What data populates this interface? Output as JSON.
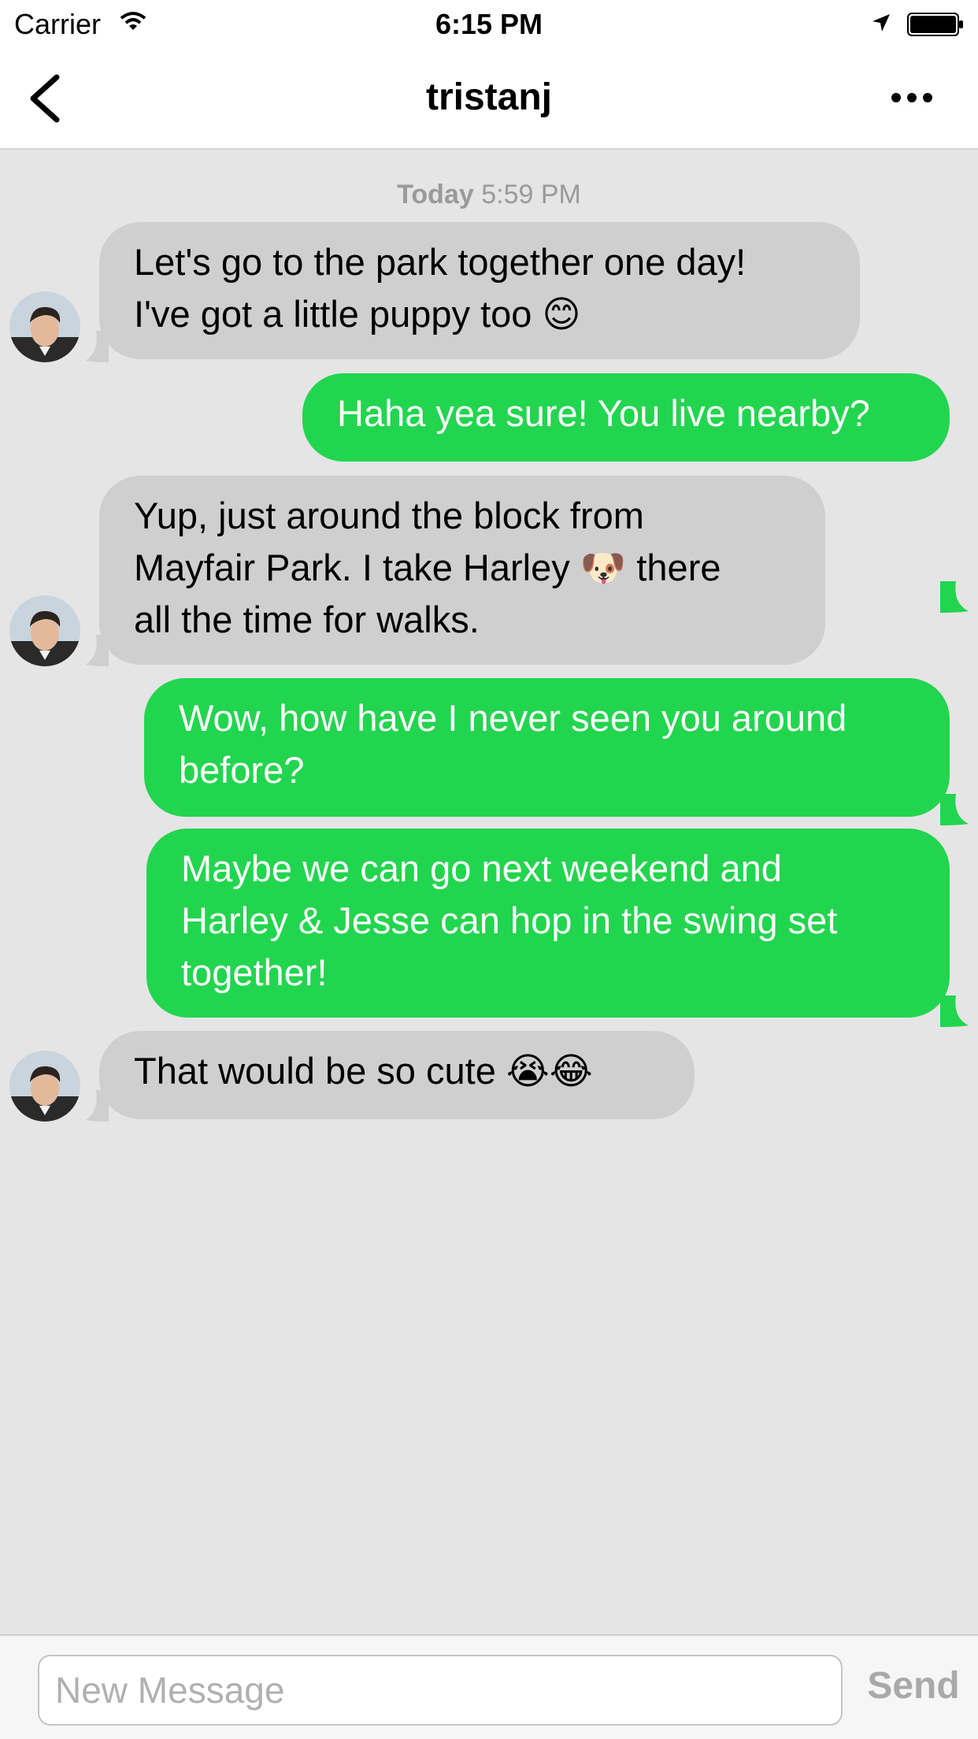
{
  "status_bar": {
    "carrier": "Carrier",
    "time": "6:15 PM"
  },
  "nav": {
    "title": "tristanj",
    "back_icon": "chevron-left-icon",
    "more_icon": "ellipsis-icon"
  },
  "thread": {
    "timestamp_day": "Today",
    "timestamp_time": "5:59 PM",
    "messages": [
      {
        "direction": "incoming",
        "lines": [
          "Let's go to the park together one day!",
          "I've got a little puppy too 😊"
        ]
      },
      {
        "direction": "outgoing",
        "lines": [
          "Haha yea sure! You live nearby?"
        ]
      },
      {
        "direction": "incoming",
        "lines": [
          "Yup, just around the block from",
          "Mayfair Park. I take Harley 🐶 there",
          "all the time for walks."
        ]
      },
      {
        "direction": "outgoing",
        "lines": [
          "Wow, how have I never seen you around",
          "before?"
        ]
      },
      {
        "direction": "outgoing",
        "lines": [
          "Maybe we can go next weekend and",
          "Harley & Jesse can hop in the swing set",
          "together!"
        ]
      },
      {
        "direction": "incoming",
        "lines": [
          "That would be so cute 😭😂"
        ]
      }
    ]
  },
  "composer": {
    "placeholder": "New Message",
    "send_label": "Send"
  },
  "colors": {
    "outgoing_bubble": "#22d54e",
    "incoming_bubble": "#cfcfcf",
    "background": "#e5e5e5"
  }
}
